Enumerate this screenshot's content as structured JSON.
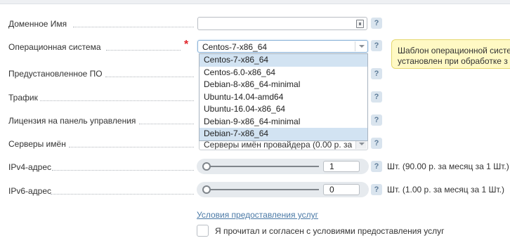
{
  "form": {
    "domain": {
      "label": "Доменное Имя",
      "value": "",
      "help": "?"
    },
    "os": {
      "label": "Операционная система",
      "required_mark": "*",
      "selected": "Centos-7-x86_64",
      "help": "?",
      "tooltip_line1": "Шаблон операционной систе",
      "tooltip_line2": "установлен при обработке з",
      "options": [
        "Centos-7-x86_64",
        "Centos-6.0-x86_64",
        "Debian-8-x86_64-minimal",
        "Ubuntu-14.04-amd64",
        "Ubuntu-16.04-x86_64",
        "Debian-9-x86_64-minimal",
        "Debian-7-x86_64"
      ]
    },
    "preinstalled": {
      "label": "Предустановленное ПО",
      "help": "?"
    },
    "traffic": {
      "label": "Трафик",
      "help": "?"
    },
    "license": {
      "label": "Лицензия на панель управления",
      "help": "?"
    },
    "nameservers": {
      "label": "Серверы имён",
      "value": "Серверы имён провайдера (0.00 р. за",
      "help": "?"
    },
    "ipv4": {
      "label": "IPv4-адрес",
      "value": "1",
      "help": "?",
      "unit": "Шт. (90.00 р. за месяц за 1 Шт.)"
    },
    "ipv6": {
      "label": "IPv6-адрес",
      "value": "0",
      "help": "?",
      "unit": "Шт. (1.00 р. за месяц за 1 Шт.)"
    },
    "terms_link": "Условия предоставления услуг",
    "terms_checkbox_label": "Я прочитал и согласен с условиями предоставления услуг",
    "terms_checked": false
  }
}
